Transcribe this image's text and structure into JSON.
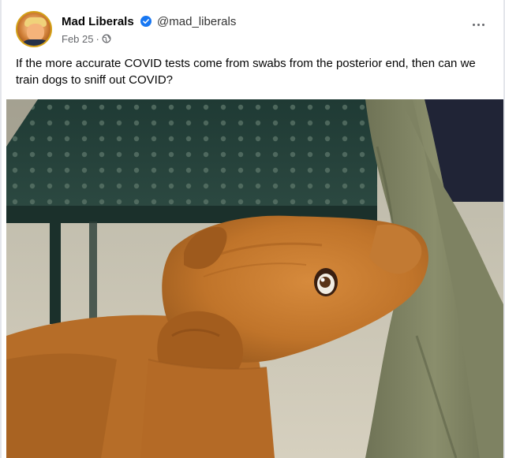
{
  "post": {
    "author_name": "Mad Liberals",
    "handle": "@mad_liberals",
    "date": "Feb 25",
    "separator": "·",
    "text": "If the more accurate COVID tests come from swabs from the posterior end, then can we train dogs to sniff out COVID?"
  },
  "icons": {
    "verified": "verified-badge-icon",
    "audience": "globe-icon",
    "more": "more-options-icon"
  },
  "colors": {
    "verified_blue": "#1877f2",
    "meta_gray": "#65676b"
  }
}
